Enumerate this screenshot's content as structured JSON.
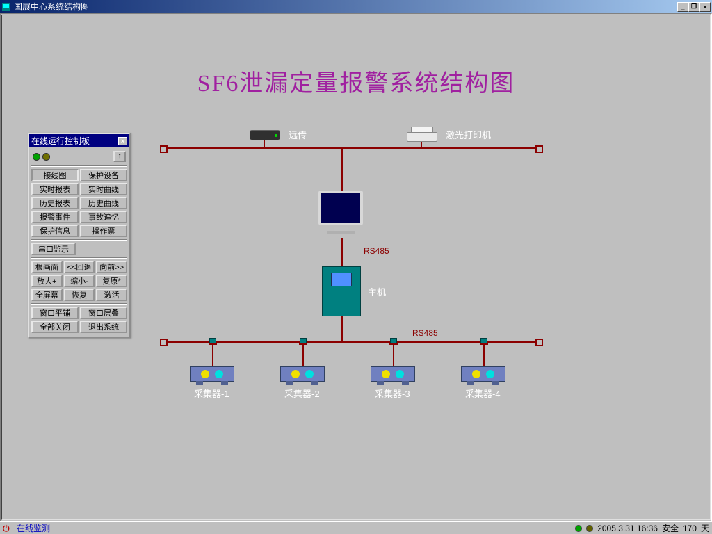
{
  "window": {
    "title": "国展中心系统结构图"
  },
  "main_title": "SF6泄漏定量报警系统结构图",
  "diagram": {
    "remote_label": "远传",
    "printer_label": "激光打印机",
    "rs485_a": "RS485",
    "rs485_b": "RS485",
    "host_label": "主机",
    "collectors": [
      "采集器-1",
      "采集器-2",
      "采集器-3",
      "采集器-4"
    ]
  },
  "panel": {
    "title": "在线运行控制板",
    "rows1": [
      [
        "接线图",
        "保护设备"
      ],
      [
        "实时报表",
        "实时曲线"
      ],
      [
        "历史报表",
        "历史曲线"
      ],
      [
        "报警事件",
        "事故追忆"
      ],
      [
        "保护信息",
        "操作票"
      ]
    ],
    "serial_btn": "串口监示",
    "rows2": [
      [
        "根画面",
        "<<回退",
        "向前>>"
      ],
      [
        "放大+",
        "缩小-",
        "复原*"
      ],
      [
        "全屏幕",
        "恢复",
        "激活"
      ]
    ],
    "rows3": [
      [
        "窗口平铺",
        "窗口层叠"
      ],
      [
        "全部关闭",
        "退出系统"
      ]
    ]
  },
  "statusbar": {
    "mode": "在线监测",
    "datetime": "2005.3.31  16:36",
    "safe_label": "安全",
    "safe_days": "170",
    "day_unit": "天"
  }
}
